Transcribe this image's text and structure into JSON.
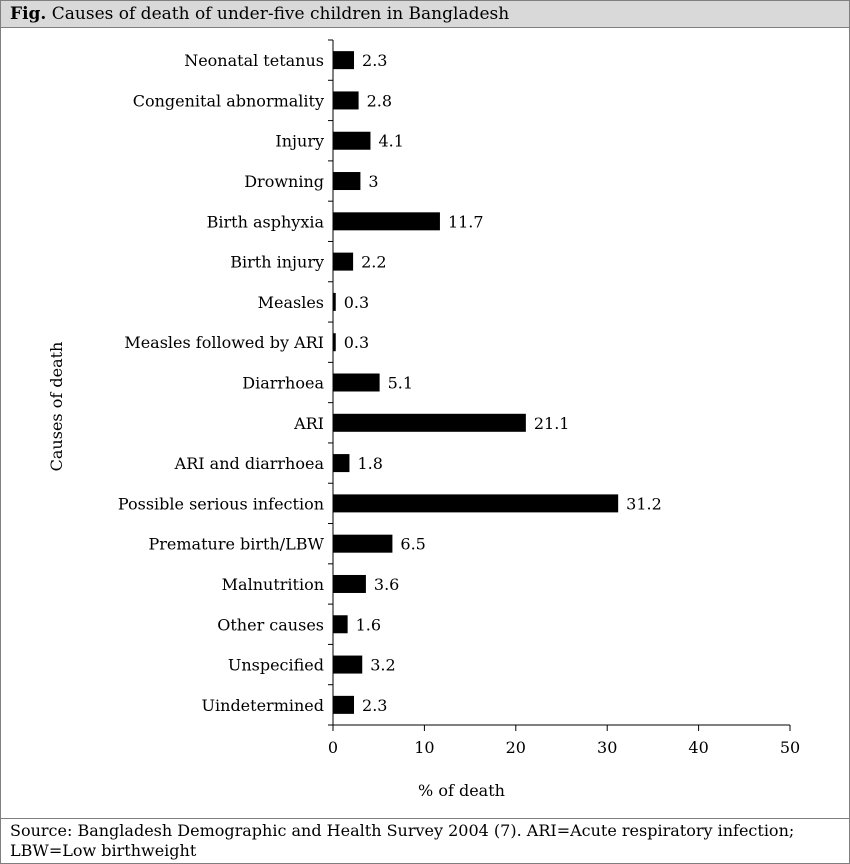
{
  "header": {
    "prefix": "Fig.",
    "title": "Causes of death of under-five children in Bangladesh"
  },
  "source_note": "Source: Bangladesh Demographic and Health Survey 2004 (7). ARI=Acute respiratory infection; LBW=Low birthweight",
  "chart_data": {
    "type": "bar",
    "orientation": "horizontal",
    "title": "Causes of death of under-five children in Bangladesh",
    "xlabel": "% of death",
    "ylabel": "Causes of death",
    "xlim": [
      0,
      50
    ],
    "xticks": [
      0,
      10,
      20,
      30,
      40,
      50
    ],
    "grid": false,
    "bar_color": "#000000",
    "categories": [
      "Neonatal tetanus",
      "Congenital abnormality",
      "Injury",
      "Drowning",
      "Birth asphyxia",
      "Birth injury",
      "Measles",
      "Measles followed by ARI",
      "Diarrhoea",
      "ARI",
      "ARI and diarrhoea",
      "Possible serious infection",
      "Premature birth/LBW",
      "Malnutrition",
      "Other causes",
      "Unspecified",
      "Uindetermined"
    ],
    "values": [
      2.3,
      2.8,
      4.1,
      3,
      11.7,
      2.2,
      0.3,
      0.3,
      5.1,
      21.1,
      1.8,
      31.2,
      6.5,
      3.6,
      1.6,
      3.2,
      2.3
    ],
    "data_labels": [
      "2.3",
      "2.8",
      "4.1",
      "3",
      "11.7",
      "2.2",
      "0.3",
      "0.3",
      "5.1",
      "21.1",
      "1.8",
      "31.2",
      "6.5",
      "3.6",
      "1.6",
      "3.2",
      "2.3"
    ]
  }
}
